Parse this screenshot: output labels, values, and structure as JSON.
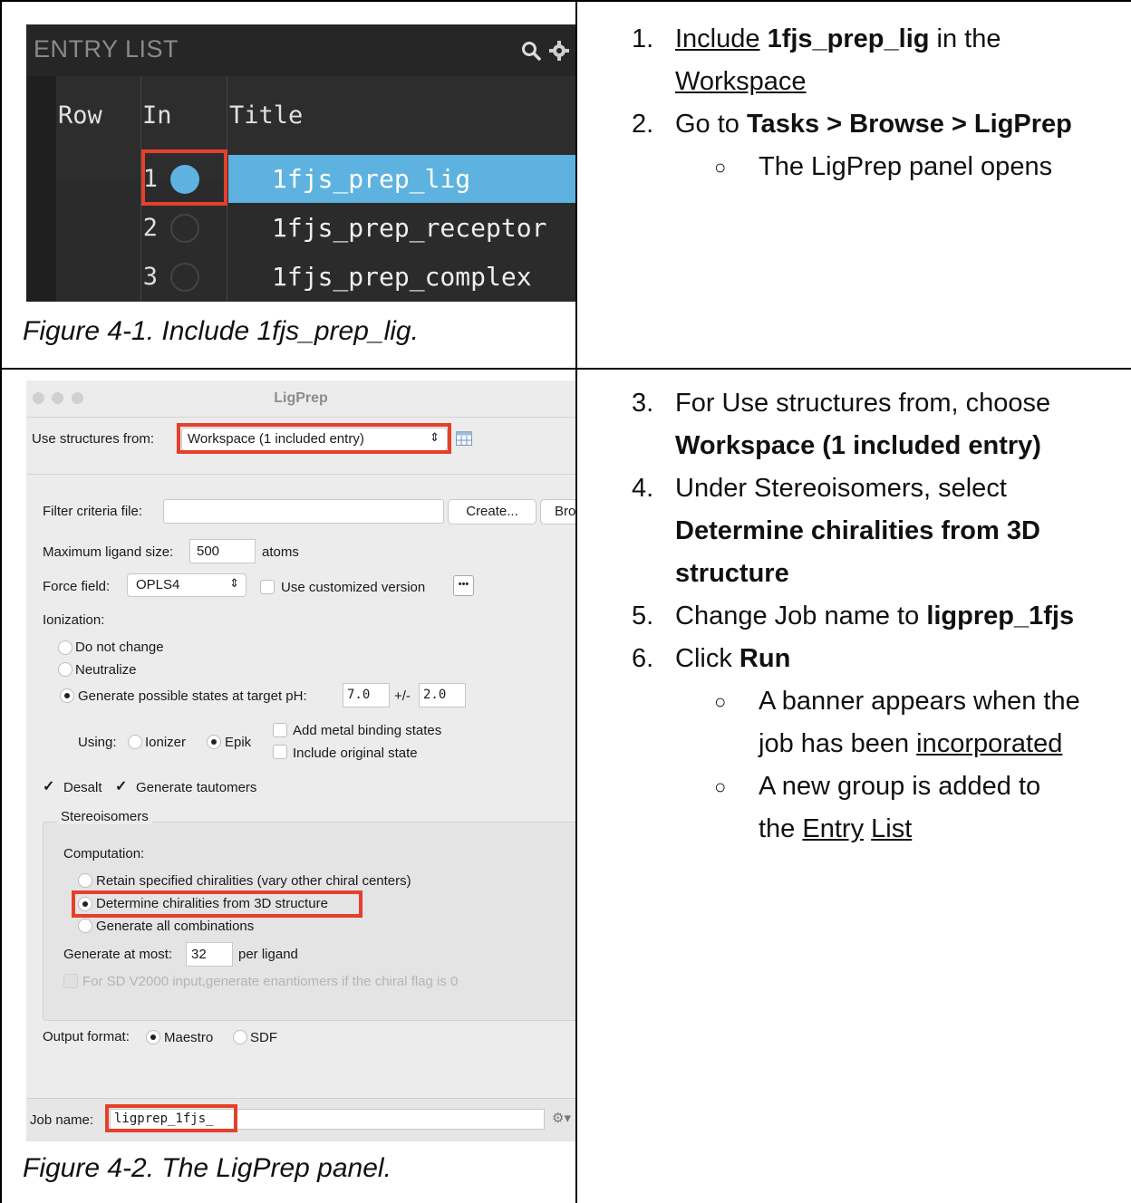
{
  "entry_list": {
    "header": "ENTRY LIST",
    "columns": [
      "Row",
      "In",
      "Title"
    ],
    "rows": [
      {
        "row": "1",
        "title": "1fjs_prep_lig",
        "included": true
      },
      {
        "row": "2",
        "title": "1fjs_prep_receptor",
        "included": false
      },
      {
        "row": "3",
        "title": "1fjs_prep_complex",
        "included": false
      }
    ],
    "colors": {
      "selection": "#5eb2df",
      "highlight": "#e4402a"
    }
  },
  "figure1_caption": "Figure 4-1. Include 1fjs_prep_lig.",
  "steps_top": {
    "s1": {
      "num": "1.",
      "include": "Include",
      "entry": "1fjs_prep_lig",
      "in_the": "in the",
      "workspace": "Workspace"
    },
    "s2": {
      "num": "2.",
      "go_to": "Go to",
      "path": "Tasks > Browse > LigPrep"
    },
    "s2_sub": "The LigPrep panel opens",
    "bullet": "○"
  },
  "ligprep": {
    "window_title": "LigPrep",
    "use_structures_label": "Use structures from:",
    "use_structures_value": "Workspace (1 included entry)",
    "filter_label": "Filter criteria file:",
    "create_button": "Create...",
    "browse_button": "Bro",
    "max_size_label": "Maximum ligand size:",
    "max_size_value": "500",
    "atoms_label": "atoms",
    "force_field_label": "Force field:",
    "force_field_value": "OPLS4",
    "use_customized": "Use customized version",
    "ionization_label": "Ionization:",
    "ion_do_not_change": "Do not change",
    "ion_neutralize": "Neutralize",
    "ion_generate": "Generate possible states at target pH:",
    "ph_value": "7.0",
    "pm_label": "+/-",
    "pm_value": "2.0",
    "using_label": "Using:",
    "ionizer": "Ionizer",
    "epik": "Epik",
    "add_metal": "Add metal binding states",
    "include_original": "Include original state",
    "desalt": "Desalt",
    "generate_tautomers": "Generate tautomers",
    "stereo_label": "Stereoisomers",
    "computation_label": "Computation:",
    "retain": "Retain specified chiralities (vary other chiral centers)",
    "determine": "Determine chiralities from 3D structure",
    "generate_all": "Generate all combinations",
    "generate_at_most_label": "Generate at most:",
    "generate_at_most_value": "32",
    "per_ligand": "per ligand",
    "sd_v2000": "For SD V2000 input,generate enantiomers if the chiral flag is 0",
    "output_format_label": "Output format:",
    "maestro": "Maestro",
    "sdf": "SDF",
    "job_name_label": "Job name:",
    "job_name_value": "ligprep_1fjs_"
  },
  "figure2_caption": "Figure 4-2. The LigPrep panel.",
  "steps_bottom": {
    "s3": {
      "num": "3.",
      "text": "For Use structures from, choose",
      "bold": "Workspace (1 included entry)"
    },
    "s4": {
      "num": "4.",
      "text": "Under Stereoisomers, select",
      "bold1": "Determine chiralities from 3D",
      "bold2": "structure"
    },
    "s5": {
      "num": "5.",
      "text": "Change Job name to",
      "bold": "ligprep_1fjs"
    },
    "s6": {
      "num": "6.",
      "text": "Click",
      "bold": "Run"
    },
    "sub1": {
      "a": "A banner appears when the",
      "b": "job has been",
      "link": "incorporated"
    },
    "sub2": {
      "a": "A new group is added to",
      "b": "the",
      "link1": "Entry",
      "link2": "List"
    },
    "bullet": "○"
  }
}
